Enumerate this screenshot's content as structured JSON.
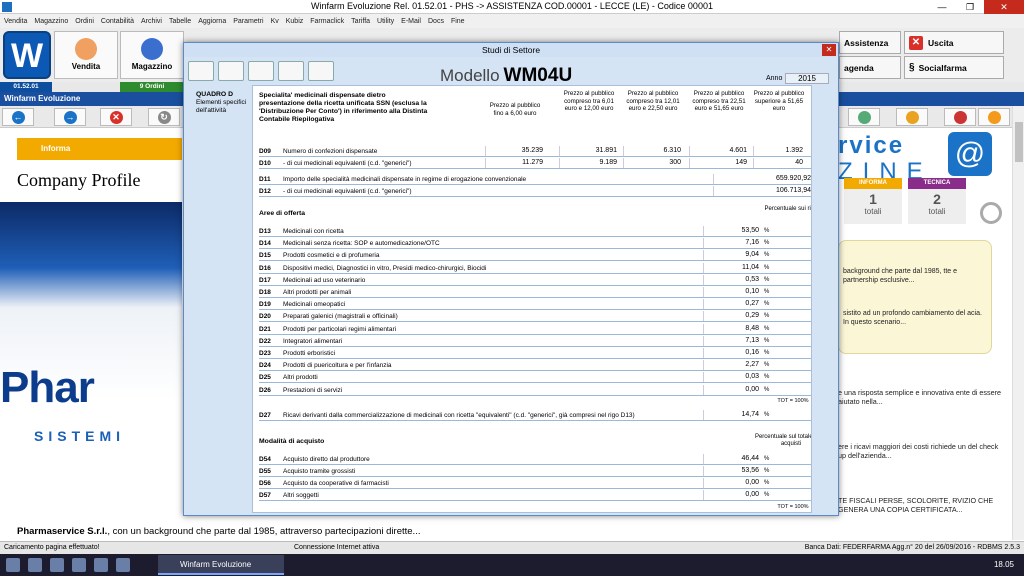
{
  "titlebar": {
    "title": "Winfarm Evoluzione Rel. 01.52.01 - PHS -> ASSISTENZA COD.00001 - LECCE (LE) - Codice 00001"
  },
  "menu": [
    "Vendita",
    "Magazzino",
    "Ordini",
    "Contabilità",
    "Archivi",
    "Tabelle",
    "Aggiorna",
    "Parametri",
    "Kv",
    "Kubiz",
    "Farmaclick",
    "Tariffa",
    "Utility",
    "E-Mail",
    "Docs",
    "Fine"
  ],
  "toolbar": {
    "vendita": "Vendita",
    "magazzino": "Magazzino",
    "assistenza": "Assistenza",
    "uscita": "Uscita",
    "agenda": "agenda",
    "socialfarma": "Socialfarma"
  },
  "statusrow": {
    "version": "01.52.01",
    "ordini": "9 Ordini"
  },
  "bluebar": "Winfarm Evoluzione",
  "leftpage": {
    "informa": "Informa",
    "company_profile": "Company Profile",
    "logo_main": "Phar",
    "logo_sub": "SISTEMI"
  },
  "bottom": {
    "company": "Pharmaservice S.r.l.",
    "text": ", con un background che parte dal 1985, attraverso partecipazioni dirette..."
  },
  "rightpage": {
    "magazine_top": "rvice",
    "magazine_bottom": "ZINE",
    "at_sign": "@",
    "cat1": {
      "header": "INFORMA",
      "num": "1",
      "label": "totali"
    },
    "cat2": {
      "header": "TECNICA",
      "num": "2",
      "label": "totali"
    },
    "yellow1": "background che parte dal 1985, tte e partnership esclusive...",
    "yellow2": "sistito ad un profondo cambiamento del acia. In questo scenario...",
    "t1": "e una risposta semplice e innovativa ente di essere aiutato nella...",
    "t2": "ere i ricavi maggiori dei costi richiede un del check up dell'azienda...",
    "t3": "TE FISCALI PERSE, SCOLORITE, RVIZIO CHE GENERA UNA COPIA CERTIFICATA..."
  },
  "statusbar": {
    "left": "Caricamento pagina effettuato!",
    "mid": "Connessione Internet attiva",
    "right": "Banca Dati: FEDERFARMA Agg.n° 20 del 26/09/2016 - RDBMS 2.5.3"
  },
  "taskbar": {
    "active": "Winfarm Evoluzione",
    "clock": "18.05"
  },
  "dialog": {
    "title": "Studi di Settore",
    "modello_label": "Modello",
    "modello_code": "WM04U",
    "anno_label": "Anno",
    "anno": "2015",
    "quadro": {
      "title": "QUADRO D",
      "desc": "Elementi specifici dell'attività"
    },
    "specialita_title": "Specialita' medicinali dispensate dietro presentazione della ricetta unificata SSN (esclusa la 'Distribuzione Per Conto') in riferimento alla Distinta Contabile Riepilogativa",
    "cols": [
      "Prezzo al pubblico fino a 6,00 euro",
      "Prezzo al pubblico compreso tra 6,01 euro e 12,00 euro",
      "Prezzo al pubblico compreso tra 12,01 euro e 22,50 euro",
      "Prezzo al pubblico compreso tra 22,51 euro e 51,65 euro",
      "Prezzo al pubblico superiore a 51,65 euro"
    ],
    "d09": {
      "code": "D09",
      "desc": "Numero di confezioni dispensate",
      "vals": [
        "35.239",
        "31.891",
        "6.310",
        "4.601",
        "1.392"
      ]
    },
    "d10": {
      "code": "D10",
      "desc": "- di cui medicinali equivalenti (c.d. \"generici\")",
      "vals": [
        "11.279",
        "9.189",
        "300",
        "149",
        "40"
      ]
    },
    "d11": {
      "code": "D11",
      "desc": "Importo delle specialità medicinali dispensate in regime di erogazione convenzionale",
      "val": "659.920,92"
    },
    "d12": {
      "code": "D12",
      "desc": "- di cui medicinali equivalenti (c.d. \"generici\")",
      "val": "106.713,94"
    },
    "aree_title": "Aree di offerta",
    "aree_col": "Percentuale sui ricavi",
    "aree": [
      {
        "code": "D13",
        "desc": "Medicinali con ricetta",
        "val": "53,50"
      },
      {
        "code": "D14",
        "desc": "Medicinali senza ricetta: SOP e automedicazione/OTC",
        "val": "7,16"
      },
      {
        "code": "D15",
        "desc": "Prodotti cosmetici e di profumeria",
        "val": "9,04"
      },
      {
        "code": "D16",
        "desc": "Dispositivi medici, Diagnostici in vitro, Presidi medico-chirurgici, Biocidi",
        "val": "11,04"
      },
      {
        "code": "D17",
        "desc": "Medicinali ad uso veterinario",
        "val": "0,53"
      },
      {
        "code": "D18",
        "desc": "Altri prodotti per animali",
        "val": "0,10"
      },
      {
        "code": "D19",
        "desc": "Medicinali omeopatici",
        "val": "0,27"
      },
      {
        "code": "D20",
        "desc": "Preparati galenici (magistrali e officinali)",
        "val": "0,29"
      },
      {
        "code": "D21",
        "desc": "Prodotti per particolari regimi alimentari",
        "val": "8,48"
      },
      {
        "code": "D22",
        "desc": "Integratori alimentari",
        "val": "7,13"
      },
      {
        "code": "D23",
        "desc": "Prodotti erboristici",
        "val": "0,16"
      },
      {
        "code": "D24",
        "desc": "Prodotti di puericoltura e per l'infanzia",
        "val": "2,27"
      },
      {
        "code": "D25",
        "desc": "Altri prodotti",
        "val": "0,03"
      },
      {
        "code": "D26",
        "desc": "Prestazioni di servizi",
        "val": "0,00"
      }
    ],
    "tot": "TOT = 100%",
    "d27": {
      "code": "D27",
      "desc": "Ricavi derivanti dalla commercializzazione di medicinali con ricetta \"equivalenti\" (c.d. \"generici\", già compresi nel rigo D13)",
      "val": "14,74"
    },
    "modalita_title": "Modalità di acquisto",
    "modalita_col": "Percentuale sul totale degli acquisti",
    "modalita": [
      {
        "code": "D54",
        "desc": "Acquisto diretto dal produttore",
        "val": "46,44"
      },
      {
        "code": "D55",
        "desc": "Acquisto tramite grossisti",
        "val": "53,56"
      },
      {
        "code": "D56",
        "desc": "Acquisto da cooperative di farmacisti",
        "val": "0,00"
      },
      {
        "code": "D57",
        "desc": "Altri soggetti",
        "val": "0,00"
      }
    ],
    "pct": "%"
  }
}
